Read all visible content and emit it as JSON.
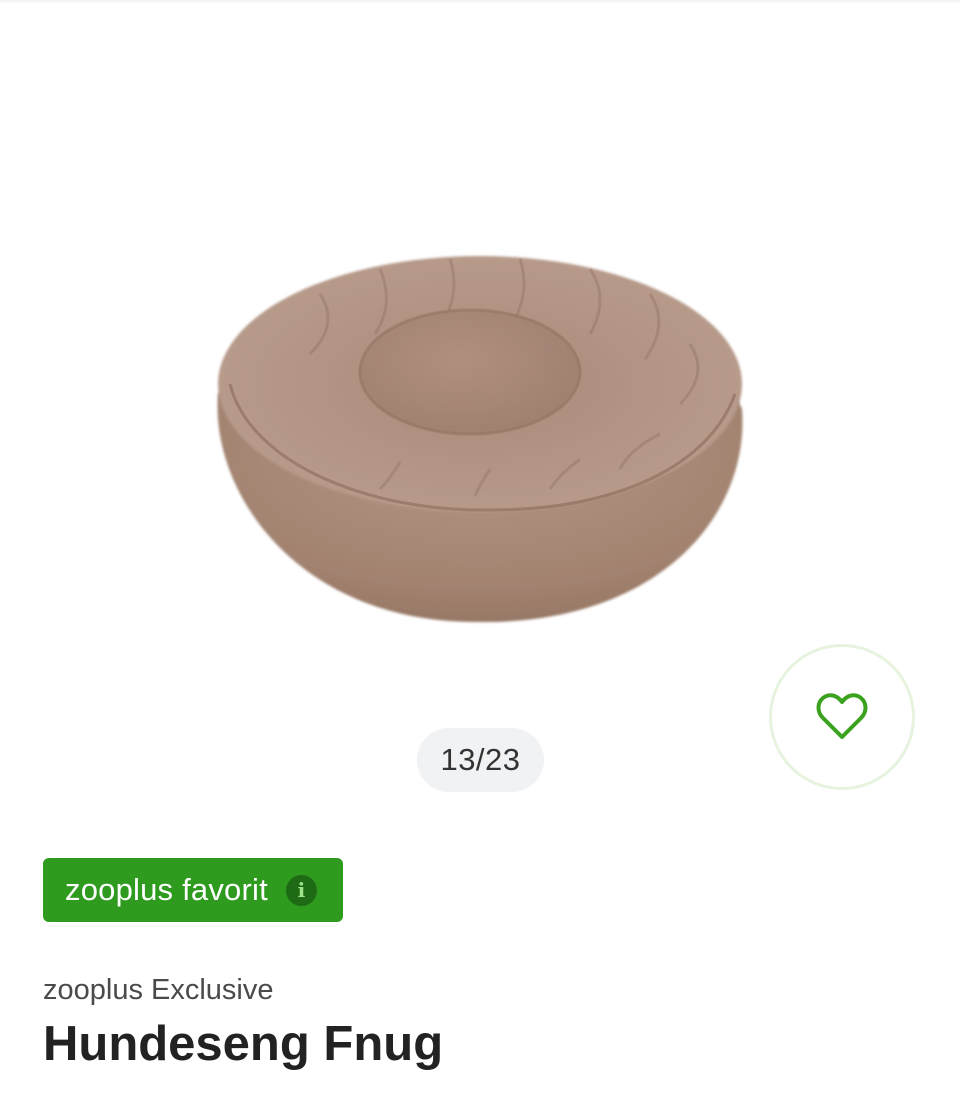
{
  "gallery": {
    "counter": "13/23",
    "product_image_alt": "Hundeseng Fnug",
    "favorite_icon": "heart-outline-icon",
    "colors": {
      "bed": "#a98b7b",
      "accent": "#3aa21e"
    }
  },
  "product": {
    "badge_label": "zooplus favorit",
    "badge_icon": "info-icon",
    "badge_icon_glyph": "i",
    "brand": "zooplus Exclusive",
    "title": "Hundeseng Fnug"
  },
  "colors": {
    "badge_bg": "#2e9b1e",
    "badge_text": "#ffffff",
    "heart": "#3aa21e",
    "pill_bg": "#f1f2f4"
  }
}
